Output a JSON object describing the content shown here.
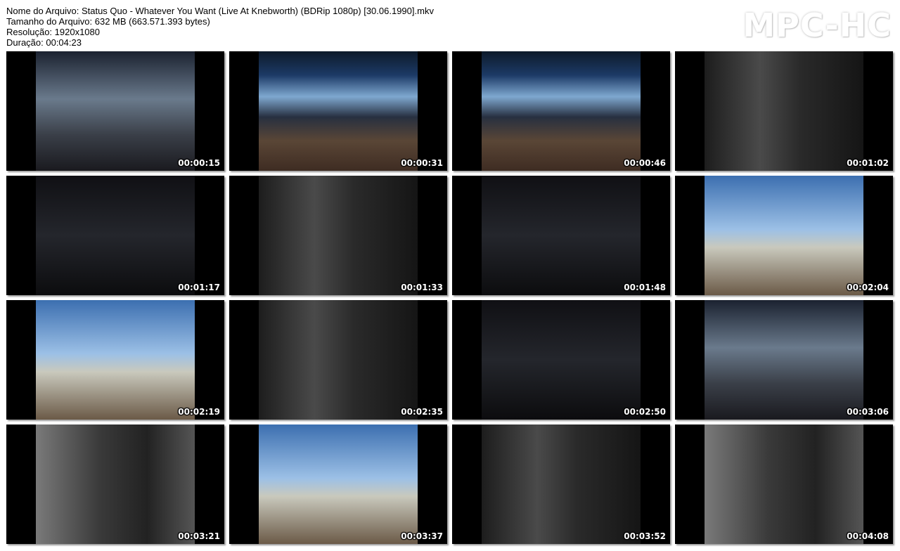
{
  "header": {
    "file_name": "Nome do Arquivo: Status Quo - Whatever You Want (Live At Knebworth) (BDRip 1080p) [30.06.1990].mkv",
    "file_size": "Tamanho do Arquivo: 632 MB (663.571.393 bytes)",
    "resolution": "Resolução: 1920x1080",
    "duration": "Duração: 00:04:23"
  },
  "brand": "MPC-HC",
  "thumbnails": [
    {
      "time": "00:00:15",
      "scene": "stage"
    },
    {
      "time": "00:00:31",
      "scene": "crowd"
    },
    {
      "time": "00:00:46",
      "scene": "crowd"
    },
    {
      "time": "00:01:02",
      "scene": "amp"
    },
    {
      "time": "00:01:17",
      "scene": "dark"
    },
    {
      "time": "00:01:33",
      "scene": "amp"
    },
    {
      "time": "00:01:48",
      "scene": "dark"
    },
    {
      "time": "00:02:04",
      "scene": "sky"
    },
    {
      "time": "00:02:19",
      "scene": "sky"
    },
    {
      "time": "00:02:35",
      "scene": "amp"
    },
    {
      "time": "00:02:50",
      "scene": "dark"
    },
    {
      "time": "00:03:06",
      "scene": "stage"
    },
    {
      "time": "00:03:21",
      "scene": "amp2"
    },
    {
      "time": "00:03:37",
      "scene": "sky"
    },
    {
      "time": "00:03:52",
      "scene": "amp"
    },
    {
      "time": "00:04:08",
      "scene": "amp2"
    }
  ]
}
